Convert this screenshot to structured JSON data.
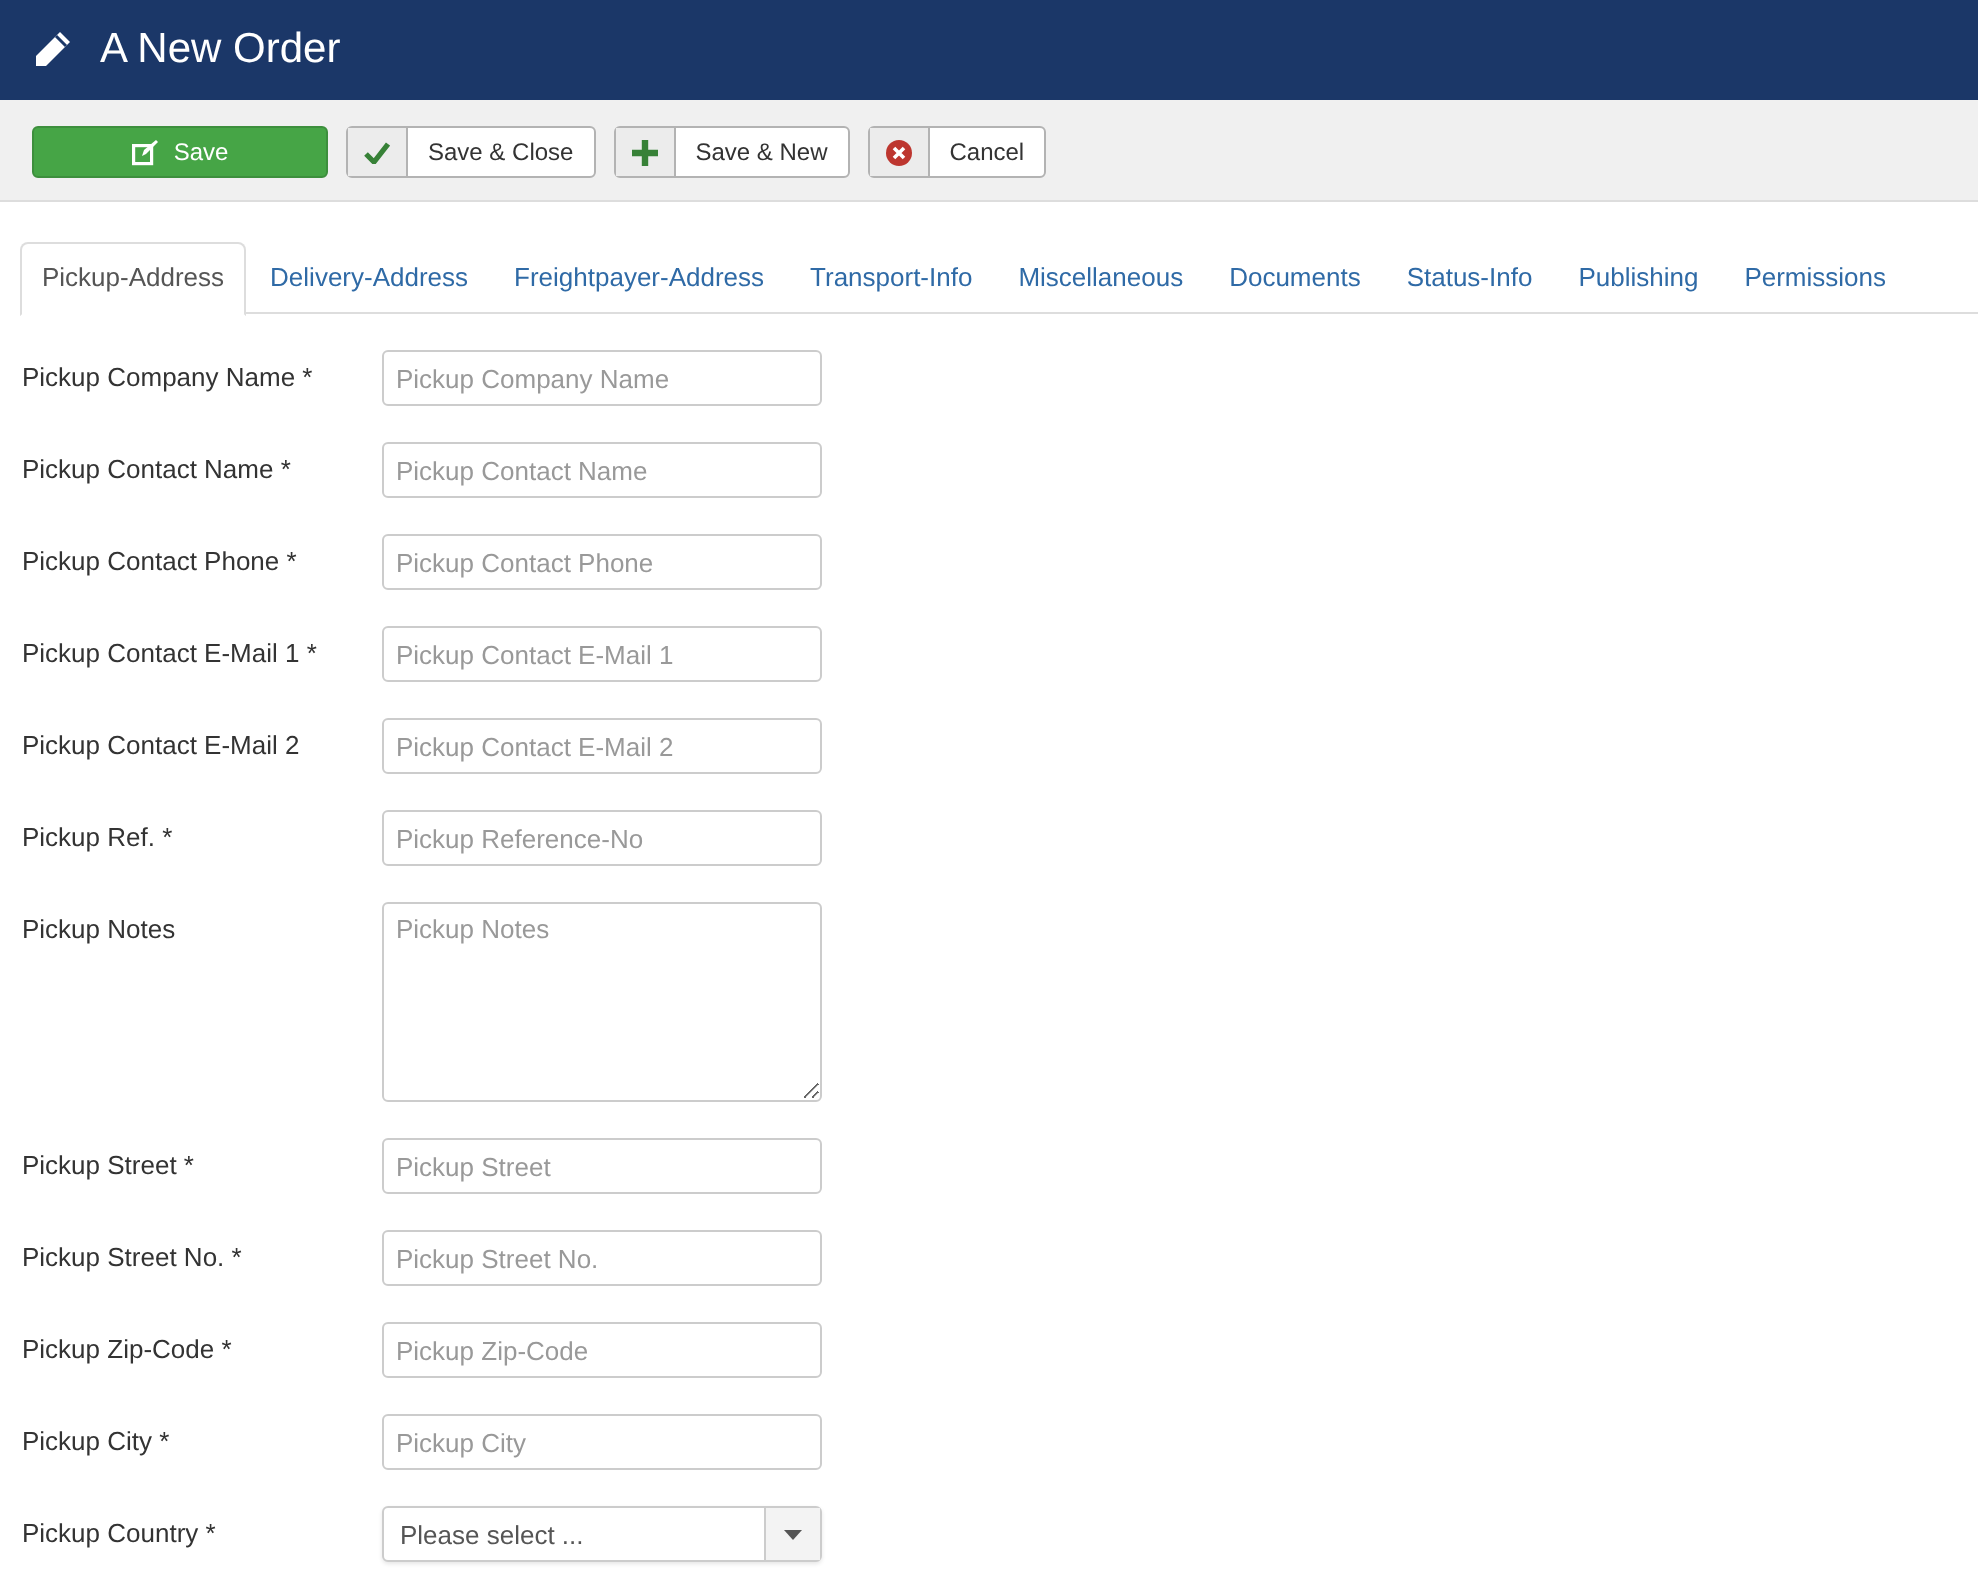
{
  "header": {
    "title": "A New Order"
  },
  "toolbar": [
    {
      "label": "Save",
      "kind": "save"
    },
    {
      "label": "Save & Close",
      "kind": "save-close"
    },
    {
      "label": "Save & New",
      "kind": "save-new"
    },
    {
      "label": "Cancel",
      "kind": "cancel"
    }
  ],
  "tabs": [
    {
      "label": "Pickup-Address",
      "selected": true
    },
    {
      "label": "Delivery-Address",
      "selected": false
    },
    {
      "label": "Freightpayer-Address",
      "selected": false
    },
    {
      "label": "Transport-Info",
      "selected": false
    },
    {
      "label": "Miscellaneous",
      "selected": false
    },
    {
      "label": "Documents",
      "selected": false
    },
    {
      "label": "Status-Info",
      "selected": false
    },
    {
      "label": "Publishing",
      "selected": false
    },
    {
      "label": "Permissions",
      "selected": false
    }
  ],
  "form": [
    {
      "label": "Pickup Company Name *",
      "kind": "text",
      "placeholder": "Pickup Company Name"
    },
    {
      "label": "Pickup Contact Name *",
      "kind": "text",
      "placeholder": "Pickup Contact Name"
    },
    {
      "label": "Pickup Contact Phone *",
      "kind": "text",
      "placeholder": "Pickup Contact Phone"
    },
    {
      "label": "Pickup Contact E-Mail 1 *",
      "kind": "text",
      "placeholder": "Pickup Contact E-Mail 1"
    },
    {
      "label": "Pickup Contact E-Mail 2",
      "kind": "text",
      "placeholder": "Pickup Contact E-Mail 2"
    },
    {
      "label": "Pickup Ref. *",
      "kind": "text",
      "placeholder": "Pickup Reference-No"
    },
    {
      "label": "Pickup Notes",
      "kind": "textarea",
      "placeholder": "Pickup Notes"
    },
    {
      "label": "Pickup Street *",
      "kind": "text",
      "placeholder": "Pickup Street"
    },
    {
      "label": "Pickup Street No. *",
      "kind": "text",
      "placeholder": "Pickup Street No."
    },
    {
      "label": "Pickup Zip-Code *",
      "kind": "text",
      "placeholder": "Pickup Zip-Code"
    },
    {
      "label": "Pickup City *",
      "kind": "text",
      "placeholder": "Pickup City"
    },
    {
      "label": "Pickup Country *",
      "kind": "select",
      "value": "Please select ..."
    }
  ]
}
